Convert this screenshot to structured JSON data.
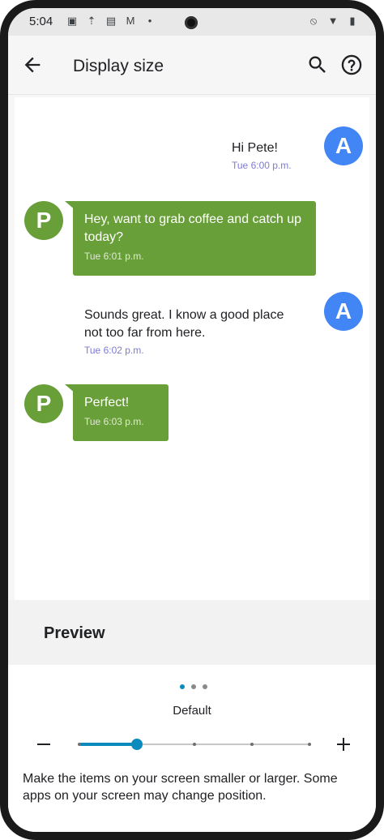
{
  "status_bar": {
    "time": "5:04",
    "left_icons": [
      "screenshot-icon",
      "upload-icon",
      "sim-icon",
      "gmail-icon",
      "dot-icon"
    ],
    "right_icons": [
      "notifications-off-icon",
      "wifi-icon",
      "battery-icon"
    ]
  },
  "app_bar": {
    "title": "Display size"
  },
  "messages": [
    {
      "sender": "A",
      "text": "Hi Pete!",
      "time": "Tue 6:00 p.m."
    },
    {
      "sender": "P",
      "text": "Hey, want to grab coffee and catch up today?",
      "time": "Tue 6:01 p.m."
    },
    {
      "sender": "A",
      "text": "Sounds great. I know a good place not too far from here.",
      "time": "Tue 6:02 p.m."
    },
    {
      "sender": "P",
      "text": "Perfect!",
      "time": "Tue 6:03 p.m."
    }
  ],
  "preview": {
    "title": "Preview"
  },
  "size_control": {
    "current_label": "Default",
    "steps": 5,
    "selected_index": 1,
    "description": "Make the items on your screen smaller or larger. Some apps on your screen may change position."
  },
  "colors": {
    "accent": "#0b8bbd",
    "avatar_a": "#4285f4",
    "avatar_p": "#689f38",
    "timestamp": "#7e7bd1"
  }
}
